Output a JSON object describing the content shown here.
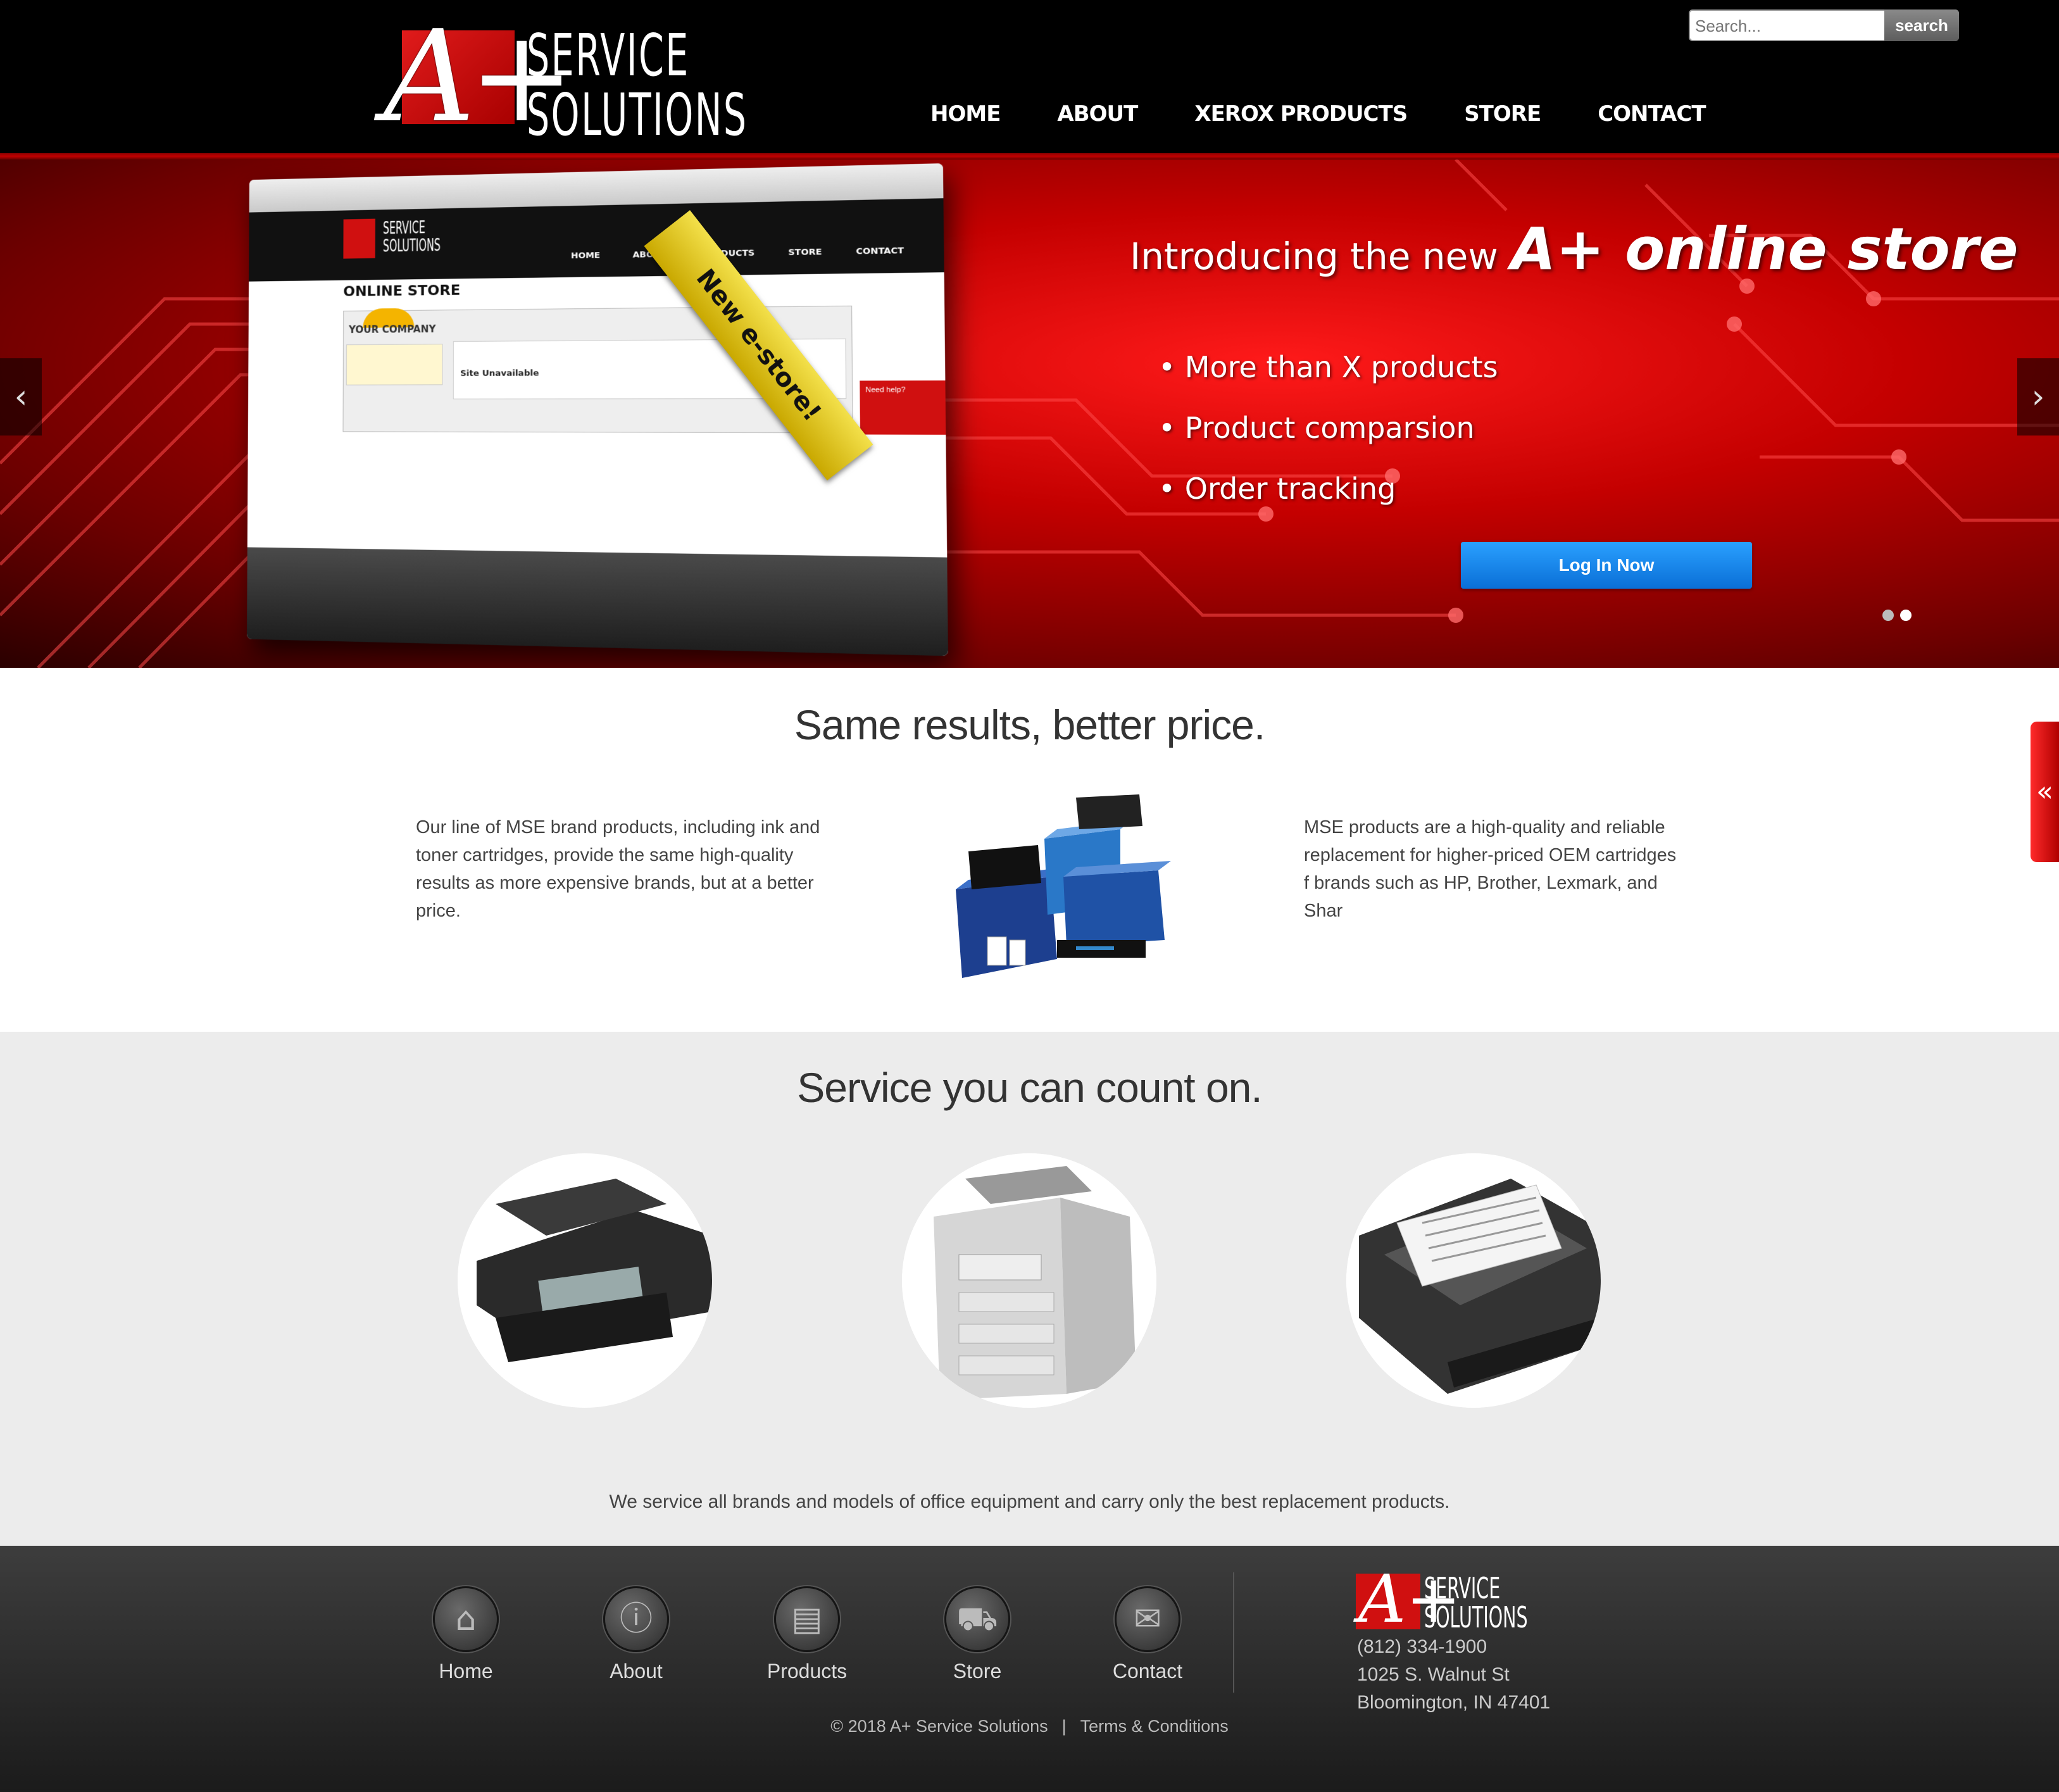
{
  "header": {
    "logo": {
      "mark": "A+",
      "line1": "SERVICE",
      "line2": "SOLUTIONS"
    },
    "search": {
      "placeholder": "Search...",
      "button": "search"
    },
    "nav": [
      "HOME",
      "ABOUT",
      "XEROX PRODUCTS",
      "STORE",
      "CONTACT"
    ]
  },
  "hero": {
    "title_a": "Introducing the new",
    "title_b": "A+ online store",
    "bullets": [
      "• More than X products",
      "• Product comparsion",
      "• Order tracking"
    ],
    "login_button": "Log In Now",
    "prev_arrow": "‹",
    "next_arrow": "›",
    "slides": 2,
    "active_slide": 2,
    "mock": {
      "logo_line1": "SERVICE",
      "logo_line2": "SOLUTIONS",
      "nav": "HOME ABOUT PRODUCTS STORE CONTACT",
      "page_title": "ONLINE STORE",
      "company": "YOUR COMPANY",
      "unavailable": "Site Unavailable",
      "need_help": "Need help?",
      "ribbon": "New e-store!"
    }
  },
  "section1": {
    "title": "Same results, better price.",
    "left_text": "Our line of MSE brand products, including ink and toner cartridges, provide the same high-quality results as more expensive brands, but at a better price.",
    "right_text": "MSE products are a high-quality and reliable replacement for higher-priced OEM cartridges f brands such as HP, Brother, Lexmark, and Shar",
    "side_tab": "«"
  },
  "section2": {
    "title": "Service you can count on.",
    "caption": "We service all brands and models of office equipment and carry only the best replacement products."
  },
  "footer": {
    "links": [
      {
        "label": "Home",
        "icon": "⌂"
      },
      {
        "label": "About",
        "icon": "ⓘ"
      },
      {
        "label": "Products",
        "icon": "▤"
      },
      {
        "label": "Store",
        "icon": "⛟"
      },
      {
        "label": "Contact",
        "icon": "✉"
      }
    ],
    "logo": {
      "mark": "A+",
      "line1": "SERVICE",
      "line2": "SOLUTIONS"
    },
    "phone": "(812) 334-1900",
    "street": "1025 S. Walnut St",
    "city": "Bloomington, IN 47401",
    "copyright": "© 2018 A+ Service Solutions",
    "separator": "|",
    "terms": "Terms & Conditions"
  }
}
